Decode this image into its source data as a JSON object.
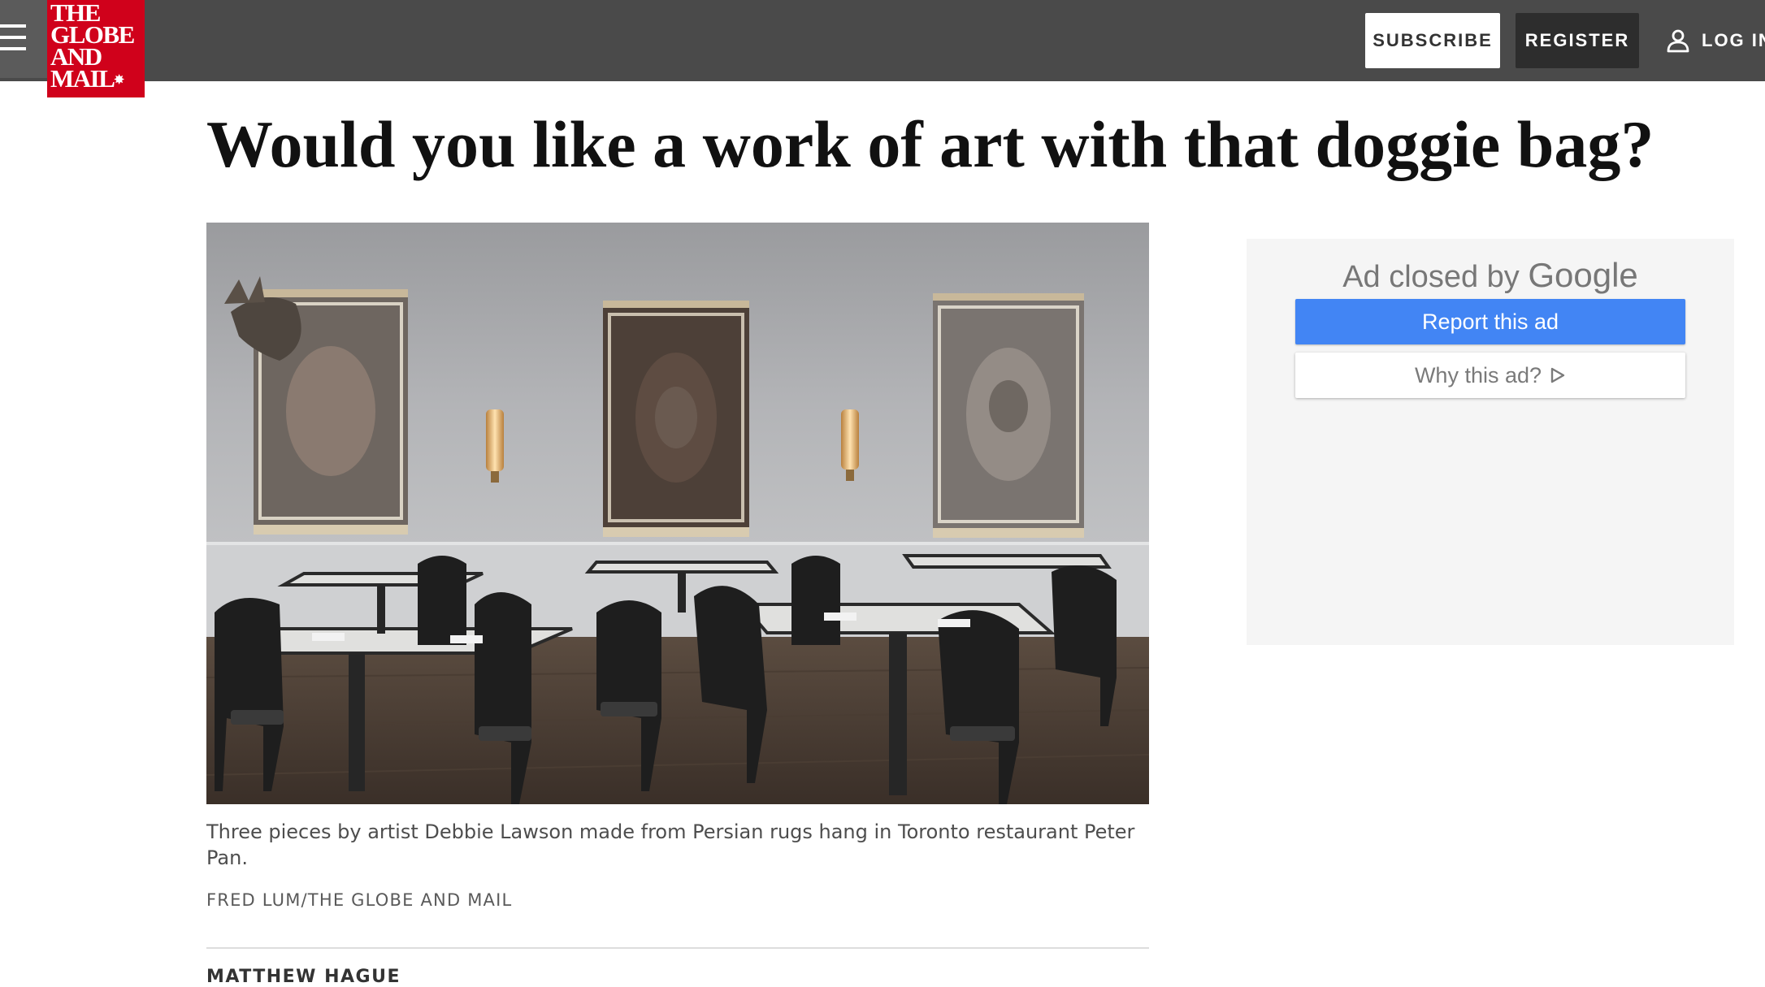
{
  "header": {
    "logo_lines": [
      "THE",
      "GLOBE",
      "AND",
      "MAIL"
    ],
    "subscribe_label": "SUBSCRIBE",
    "register_label": "REGISTER",
    "login_label": "LOG IN"
  },
  "article": {
    "headline": "Would you like a work of art with that doggie bag?",
    "image_caption": "Three pieces by artist Debbie Lawson made from Persian rugs hang in Toronto restaurant Peter Pan.",
    "image_credit": "FRED LUM/THE GLOBE AND MAIL",
    "author": "MATTHEW HAGUE"
  },
  "ad": {
    "closed_prefix": "Ad closed by",
    "closed_brand": "Google",
    "report_label": "Report this ad",
    "why_label": "Why this ad?"
  },
  "icons": {
    "menu": "hamburger-menu-icon",
    "logo_mark": "maple-leaf-icon",
    "login": "user-icon",
    "why_ad": "adchoices-icon"
  },
  "colors": {
    "topbar": "#4a4a4a",
    "brand_red": "#d0011b",
    "register_bg": "#2d2d2d",
    "ad_button_blue": "#4285f4"
  }
}
